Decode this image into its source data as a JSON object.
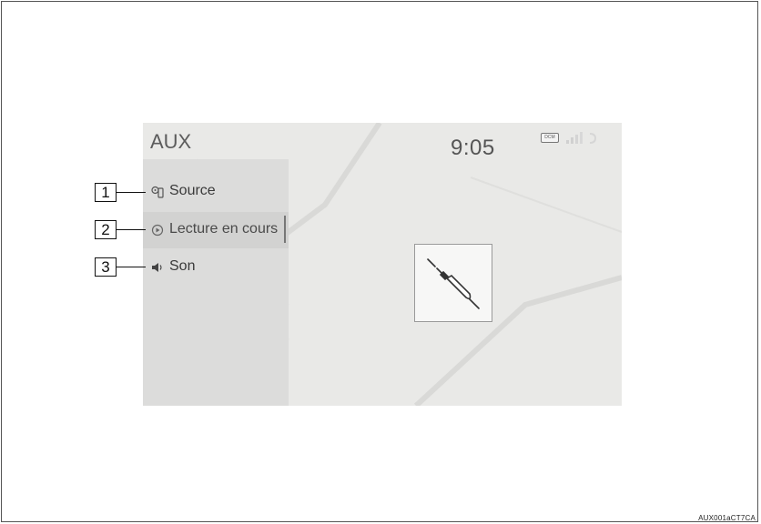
{
  "screen": {
    "title": "AUX",
    "clock": "9:05",
    "dcm_badge": "DCM",
    "colors": {
      "background": "#e9e9e7",
      "panel": "#dcdcdb",
      "text": "#3a3a3a"
    }
  },
  "menu": {
    "items": [
      {
        "label": "Source",
        "icon": "source-icon",
        "active": false
      },
      {
        "label": "Lecture en cours",
        "icon": "play-circle-icon",
        "active": true
      },
      {
        "label": "Son",
        "icon": "speaker-icon",
        "active": false
      }
    ]
  },
  "main": {
    "tile_icon": "aux-cable-icon"
  },
  "callouts": [
    "1",
    "2",
    "3"
  ],
  "figure_code": "AUX001aCT7CA"
}
